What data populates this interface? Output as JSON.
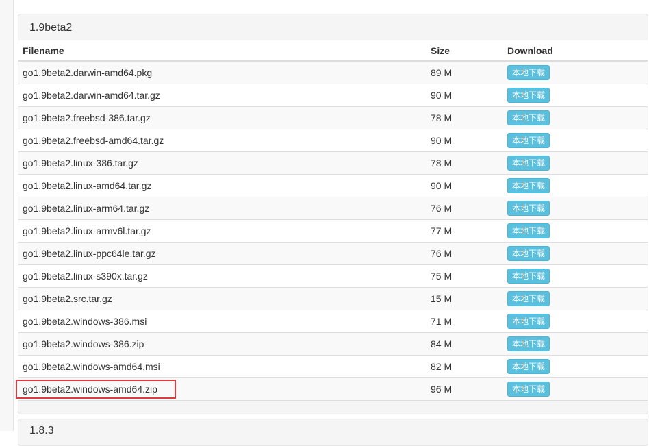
{
  "section": {
    "title": "1.9beta2",
    "columns": [
      "Filename",
      "Size",
      "Download"
    ],
    "download_label": "本地下载",
    "rows": [
      {
        "filename": "go1.9beta2.darwin-amd64.pkg",
        "size": "89 M"
      },
      {
        "filename": "go1.9beta2.darwin-amd64.tar.gz",
        "size": "90 M"
      },
      {
        "filename": "go1.9beta2.freebsd-386.tar.gz",
        "size": "78 M"
      },
      {
        "filename": "go1.9beta2.freebsd-amd64.tar.gz",
        "size": "90 M"
      },
      {
        "filename": "go1.9beta2.linux-386.tar.gz",
        "size": "78 M"
      },
      {
        "filename": "go1.9beta2.linux-amd64.tar.gz",
        "size": "90 M"
      },
      {
        "filename": "go1.9beta2.linux-arm64.tar.gz",
        "size": "76 M"
      },
      {
        "filename": "go1.9beta2.linux-armv6l.tar.gz",
        "size": "77 M"
      },
      {
        "filename": "go1.9beta2.linux-ppc64le.tar.gz",
        "size": "76 M"
      },
      {
        "filename": "go1.9beta2.linux-s390x.tar.gz",
        "size": "75 M"
      },
      {
        "filename": "go1.9beta2.src.tar.gz",
        "size": "15 M"
      },
      {
        "filename": "go1.9beta2.windows-386.msi",
        "size": "71 M"
      },
      {
        "filename": "go1.9beta2.windows-386.zip",
        "size": "84 M"
      },
      {
        "filename": "go1.9beta2.windows-amd64.msi",
        "size": "82 M"
      },
      {
        "filename": "go1.9beta2.windows-amd64.zip",
        "size": "96 M"
      }
    ]
  },
  "next_section": {
    "title": "1.8.3"
  },
  "colors": {
    "button_bg": "#5bc0de",
    "highlight_border": "#e0393e"
  }
}
